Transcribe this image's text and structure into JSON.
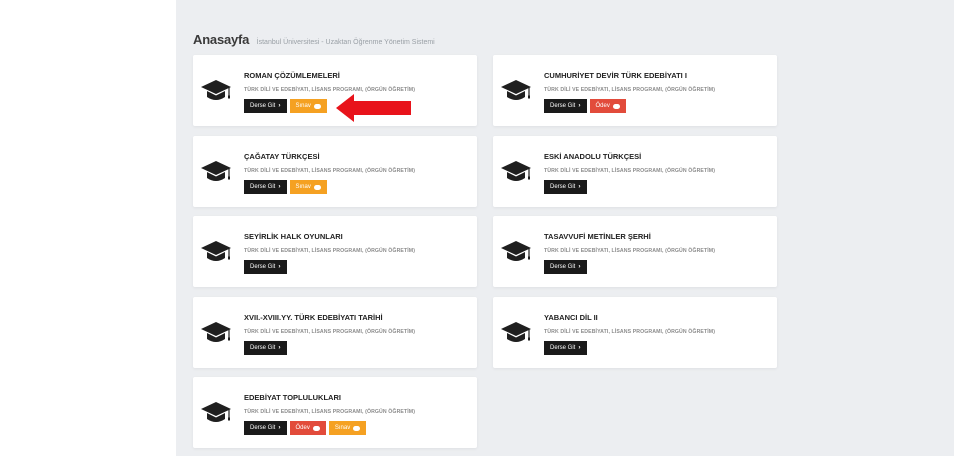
{
  "header": {
    "title": "Anasayfa",
    "subtitle": "İstanbul Üniversitesi - Uzaktan Öğrenme Yönetim Sistemi"
  },
  "buttons": {
    "go_course": "Derse Git",
    "exam": "Sınav",
    "assignment": "Ödev"
  },
  "courses": [
    {
      "title": "ROMAN ÇÖZÜMLEMELERİ",
      "program": "TÜRK DİLİ VE EDEBİYATI, LİSANS PROGRAMI, (ÖRGÜN ÖĞRETİM)"
    },
    {
      "title": "CUMHURİYET DEVİR TÜRK EDEBİYATI I",
      "program": "TÜRK DİLİ VE EDEBİYATI, LİSANS PROGRAMI, (ÖRGÜN ÖĞRETİM)"
    },
    {
      "title": "ÇAĞATAY TÜRKÇESİ",
      "program": "TÜRK DİLİ VE EDEBİYATI, LİSANS PROGRAMI, (ÖRGÜN ÖĞRETİM)"
    },
    {
      "title": "ESKİ ANADOLU TÜRKÇESİ",
      "program": "TÜRK DİLİ VE EDEBİYATI, LİSANS PROGRAMI, (ÖRGÜN ÖĞRETİM)"
    },
    {
      "title": "SEYİRLİK HALK OYUNLARI",
      "program": "TÜRK DİLİ VE EDEBİYATI, LİSANS PROGRAMI, (ÖRGÜN ÖĞRETİM)"
    },
    {
      "title": "TASAVVUFİ METİNLER ŞERHİ",
      "program": "TÜRK DİLİ VE EDEBİYATI, LİSANS PROGRAMI, (ÖRGÜN ÖĞRETİM)"
    },
    {
      "title": "XVII.-XVIII.YY. TÜRK EDEBİYATI TARİHİ",
      "program": "TÜRK DİLİ VE EDEBİYATI, LİSANS PROGRAMI, (ÖRGÜN ÖĞRETİM)"
    },
    {
      "title": "YABANCI DİL II",
      "program": "TÜRK DİLİ VE EDEBİYATI, LİSANS PROGRAMI, (ÖRGÜN ÖĞRETİM)"
    },
    {
      "title": "EDEBİYAT TOPLULUKLARI",
      "program": "TÜRK DİLİ VE EDEBİYATI, LİSANS PROGRAMI, (ÖRGÜN ÖĞRETİM)"
    }
  ],
  "icons": {
    "course": "graduation-cap-icon",
    "go": "chevron-right-icon",
    "action": "cloud-upload-icon",
    "annotation": "red-arrow-left"
  },
  "colors": {
    "background": "#eceef1",
    "card": "#ffffff",
    "go_button": "#1a1a1a",
    "exam_button": "#f5a122",
    "assignment_button": "#e24b3b",
    "annotation_arrow": "#e8131b"
  }
}
